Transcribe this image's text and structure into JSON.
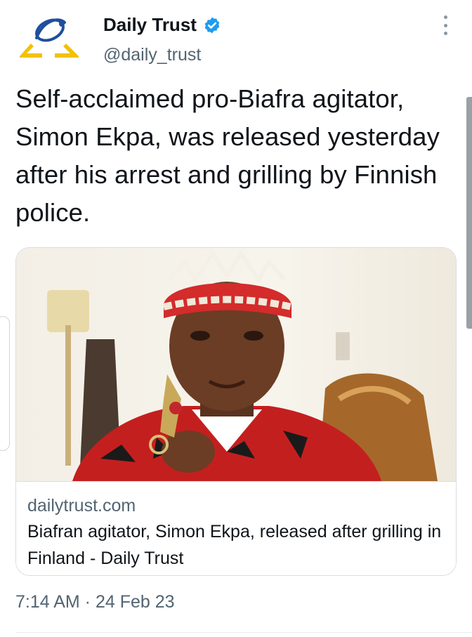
{
  "author": {
    "name": "Daily Trust",
    "handle": "@daily_trust"
  },
  "tweet": {
    "text": "Self-acclaimed pro-Biafra agitator, Simon Ekpa, was released yesterday after his arrest and grilling by Finnish police.",
    "timestamp": "7:14 AM · 24 Feb 23"
  },
  "link_card": {
    "domain": "dailytrust.com",
    "title": "Biafran agitator, Simon Ekpa, released after grilling in Finland - Daily Trust"
  },
  "colors": {
    "verified_blue": "#1d9bf0",
    "logo_blue": "#1f4e9c",
    "logo_gold": "#f2c200",
    "secondary_text": "#536471"
  },
  "icons": {
    "avatar": "daily-trust-logo",
    "verified": "verified-badge-icon",
    "more": "more-options-icon"
  }
}
